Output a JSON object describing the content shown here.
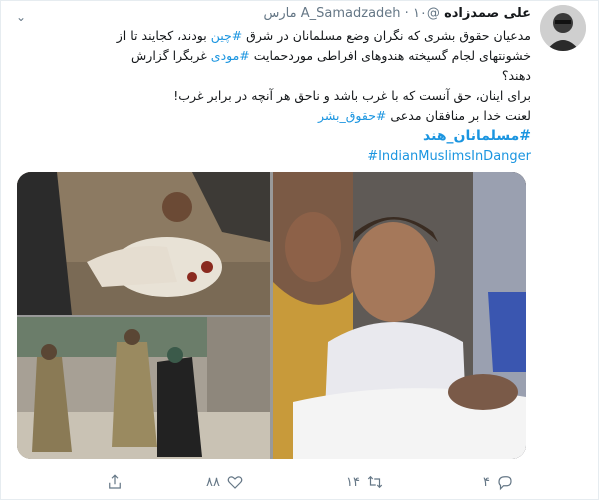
{
  "tweet": {
    "author_name": "علی صمدزاده",
    "handle": "@A_Samadzadeh",
    "separator": "·",
    "date": "۱۰ مارس",
    "lines": [
      {
        "before": "مدعیان حقوق بشری که نگران وضع مسلمانان در شرق ",
        "link": "#چین",
        "after": " بودند، کجایند تا از"
      },
      {
        "before": "خشونتهای لجام گسیخته هندوهای افراطی موردحمایت ",
        "link": "#مودی",
        "after": " غربگرا گزارش"
      },
      {
        "before": "دهند؟",
        "link": "",
        "after": ""
      },
      {
        "before": "برای اینان، حق آنست که با غرب باشد و ناحق هر آنچه در برابر غرب!",
        "link": "",
        "after": ""
      },
      {
        "before": "لعنت خدا بر منافقان مدعی ",
        "link": "#حقوق_بشر",
        "after": ""
      }
    ],
    "hashtag_persian": "#مسلمانان_هند",
    "hashtag_english": "#IndianMuslimsInDanger"
  },
  "actions": {
    "reply_count": "۴",
    "retweet_count": "۱۴",
    "like_count": "۸۸"
  },
  "icons": {
    "menu": "chevron-down-icon",
    "reply": "reply-icon",
    "retweet": "retweet-icon",
    "like": "heart-icon",
    "share": "share-icon"
  },
  "colors": {
    "link": "#1b95e0",
    "secondary_text": "#657786",
    "primary_text": "#14171a",
    "border": "#e6ecf0"
  }
}
